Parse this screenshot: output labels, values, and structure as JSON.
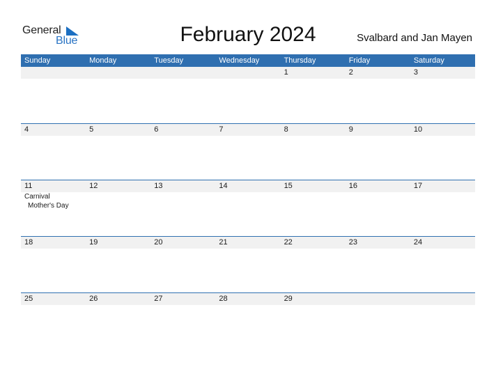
{
  "logo": {
    "word1": "General",
    "word2": "Blue",
    "icon": "triangle-flag-icon",
    "brand_color": "#2a74c4"
  },
  "header": {
    "title": "February 2024",
    "region": "Svalbard and Jan Mayen"
  },
  "colors": {
    "header_bg": "#2f6fb0",
    "date_row_bg": "#f1f1f1",
    "separator": "#2f6fb0"
  },
  "weekdays": [
    "Sunday",
    "Monday",
    "Tuesday",
    "Wednesday",
    "Thursday",
    "Friday",
    "Saturday"
  ],
  "weeks": [
    {
      "days": [
        "",
        "",
        "",
        "",
        "1",
        "2",
        "3"
      ],
      "events": [
        [],
        [],
        [],
        [],
        [],
        [],
        []
      ]
    },
    {
      "days": [
        "4",
        "5",
        "6",
        "7",
        "8",
        "9",
        "10"
      ],
      "events": [
        [],
        [],
        [],
        [],
        [],
        [],
        []
      ]
    },
    {
      "days": [
        "11",
        "12",
        "13",
        "14",
        "15",
        "16",
        "17"
      ],
      "events": [
        [
          "Carnival",
          "Mother's Day"
        ],
        [],
        [],
        [],
        [],
        [],
        []
      ]
    },
    {
      "days": [
        "18",
        "19",
        "20",
        "21",
        "22",
        "23",
        "24"
      ],
      "events": [
        [],
        [],
        [],
        [],
        [],
        [],
        []
      ]
    },
    {
      "days": [
        "25",
        "26",
        "27",
        "28",
        "29",
        "",
        ""
      ],
      "events": [
        [],
        [],
        [],
        [],
        [],
        [],
        []
      ]
    }
  ]
}
